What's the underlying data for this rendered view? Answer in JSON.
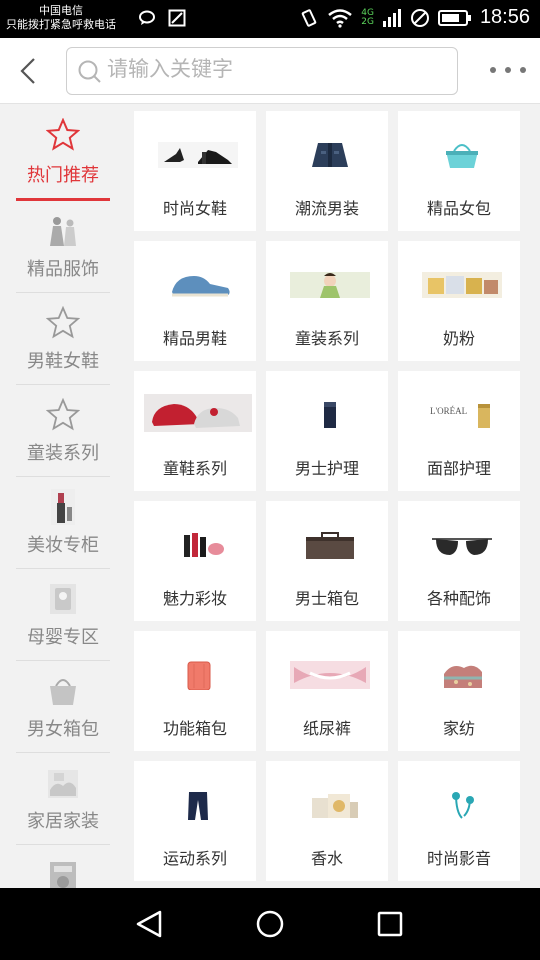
{
  "status_bar": {
    "carrier_line1": "中国电信",
    "carrier_line2": "只能拨打紧急呼救电话",
    "network": "4G",
    "network2": "2G",
    "time": "18:56"
  },
  "header": {
    "search_placeholder": "请输入关键字"
  },
  "sidebar": {
    "items": [
      {
        "label": "热门推荐",
        "icon": "star-icon",
        "active": true
      },
      {
        "label": "精品服饰",
        "icon": "clothing-icon"
      },
      {
        "label": "男鞋女鞋",
        "icon": "star-icon"
      },
      {
        "label": "童装系列",
        "icon": "star-icon"
      },
      {
        "label": "美妆专柜",
        "icon": "cosmetics-icon"
      },
      {
        "label": "母婴专区",
        "icon": "baby-icon"
      },
      {
        "label": "男女箱包",
        "icon": "bag-icon"
      },
      {
        "label": "家居家装",
        "icon": "home-icon"
      },
      {
        "label": "",
        "icon": "appliance-icon"
      }
    ]
  },
  "categories": [
    {
      "label": "时尚女鞋",
      "icon": "heels-icon"
    },
    {
      "label": "潮流男装",
      "icon": "jacket-icon"
    },
    {
      "label": "精品女包",
      "icon": "handbag-icon"
    },
    {
      "label": "精品男鞋",
      "icon": "shoe-icon"
    },
    {
      "label": "童装系列",
      "icon": "kids-icon"
    },
    {
      "label": "奶粉",
      "icon": "milk-icon"
    },
    {
      "label": "童鞋系列",
      "icon": "kids-shoe-icon"
    },
    {
      "label": "男士护理",
      "icon": "men-care-icon"
    },
    {
      "label": "面部护理",
      "icon": "face-care-icon"
    },
    {
      "label": "魅力彩妆",
      "icon": "makeup-icon"
    },
    {
      "label": "男士箱包",
      "icon": "briefcase-icon"
    },
    {
      "label": "各种配饰",
      "icon": "sunglasses-icon"
    },
    {
      "label": "功能箱包",
      "icon": "luggage-icon"
    },
    {
      "label": "纸尿裤",
      "icon": "diaper-icon"
    },
    {
      "label": "家纺",
      "icon": "bedding-icon"
    },
    {
      "label": "运动系列",
      "icon": "pants-icon"
    },
    {
      "label": "香水",
      "icon": "perfume-icon"
    },
    {
      "label": "时尚影音",
      "icon": "headphones-icon"
    }
  ],
  "colors": {
    "accent": "#e0363a",
    "sidebar_text": "#888888",
    "card_text": "#333333"
  }
}
